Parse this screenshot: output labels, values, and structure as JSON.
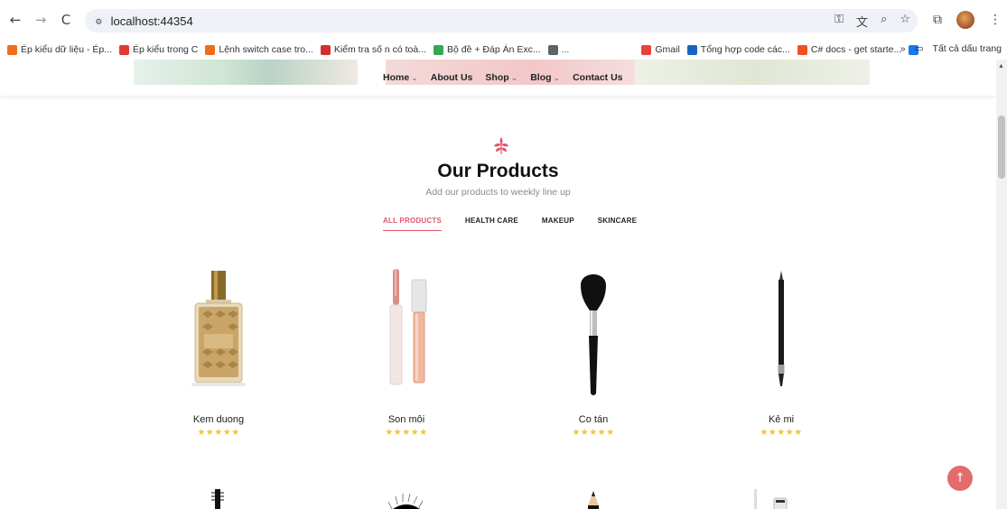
{
  "browser": {
    "url": "localhost:44354",
    "nav": {
      "back": "←",
      "forward": "→",
      "reload": "C"
    },
    "site_icon": "site-info-icon",
    "bookmarks": [
      {
        "label": "Ép kiểu dữ liệu - Ép...",
        "icon_color": "#f36b1c"
      },
      {
        "label": "Ép kiểu trong C",
        "icon_color": "#e53935"
      },
      {
        "label": "Lệnh switch case tro...",
        "icon_color": "#f36b1c"
      },
      {
        "label": "Kiểm tra số n có toà...",
        "icon_color": "#d32f2f"
      },
      {
        "label": "Bộ đề + Đáp Án Exc...",
        "icon_color": "#34a853"
      },
      {
        "label": "...",
        "icon_color": "#5f6368"
      },
      {
        "label": "Gmail",
        "icon_color": "#ea4335"
      },
      {
        "label": "Tổng hợp code các...",
        "icon_color": "#1565c0"
      },
      {
        "label": "C# docs - get starte...",
        "icon_color": "#f25022"
      },
      {
        "label": "",
        "icon_color": "#1877f2"
      }
    ],
    "overflow": "»",
    "all_bookmarks": "Tất cả dấu trang"
  },
  "site": {
    "menu": [
      {
        "label": "Home",
        "has_caret": true
      },
      {
        "label": "About Us",
        "has_caret": false
      },
      {
        "label": "Shop",
        "has_caret": true
      },
      {
        "label": "Blog",
        "has_caret": true
      },
      {
        "label": "Contact Us",
        "has_caret": false
      }
    ],
    "section_title": "Our Products",
    "section_subtitle": "Add our products to weekly line up",
    "filters": [
      "ALL PRODUCTS",
      "HEALTH CARE",
      "MAKEUP",
      "SKINCARE"
    ],
    "active_filter": "ALL PRODUCTS",
    "accent_color": "#e0566b",
    "products": [
      {
        "name": "Kem duong",
        "stars": "★★★★★",
        "rating": 5,
        "image": "body-oil-bottle"
      },
      {
        "name": "Son môi",
        "stars": "★★★★★",
        "rating": 5,
        "image": "lip-gloss"
      },
      {
        "name": "Co tán",
        "stars": "★★★★★",
        "rating": 5,
        "image": "powder-brush"
      },
      {
        "name": "Kẻ mi",
        "stars": "★★★★★",
        "rating": 5,
        "image": "eyeliner-pencil"
      }
    ],
    "scroll_top_icon": "↑"
  }
}
